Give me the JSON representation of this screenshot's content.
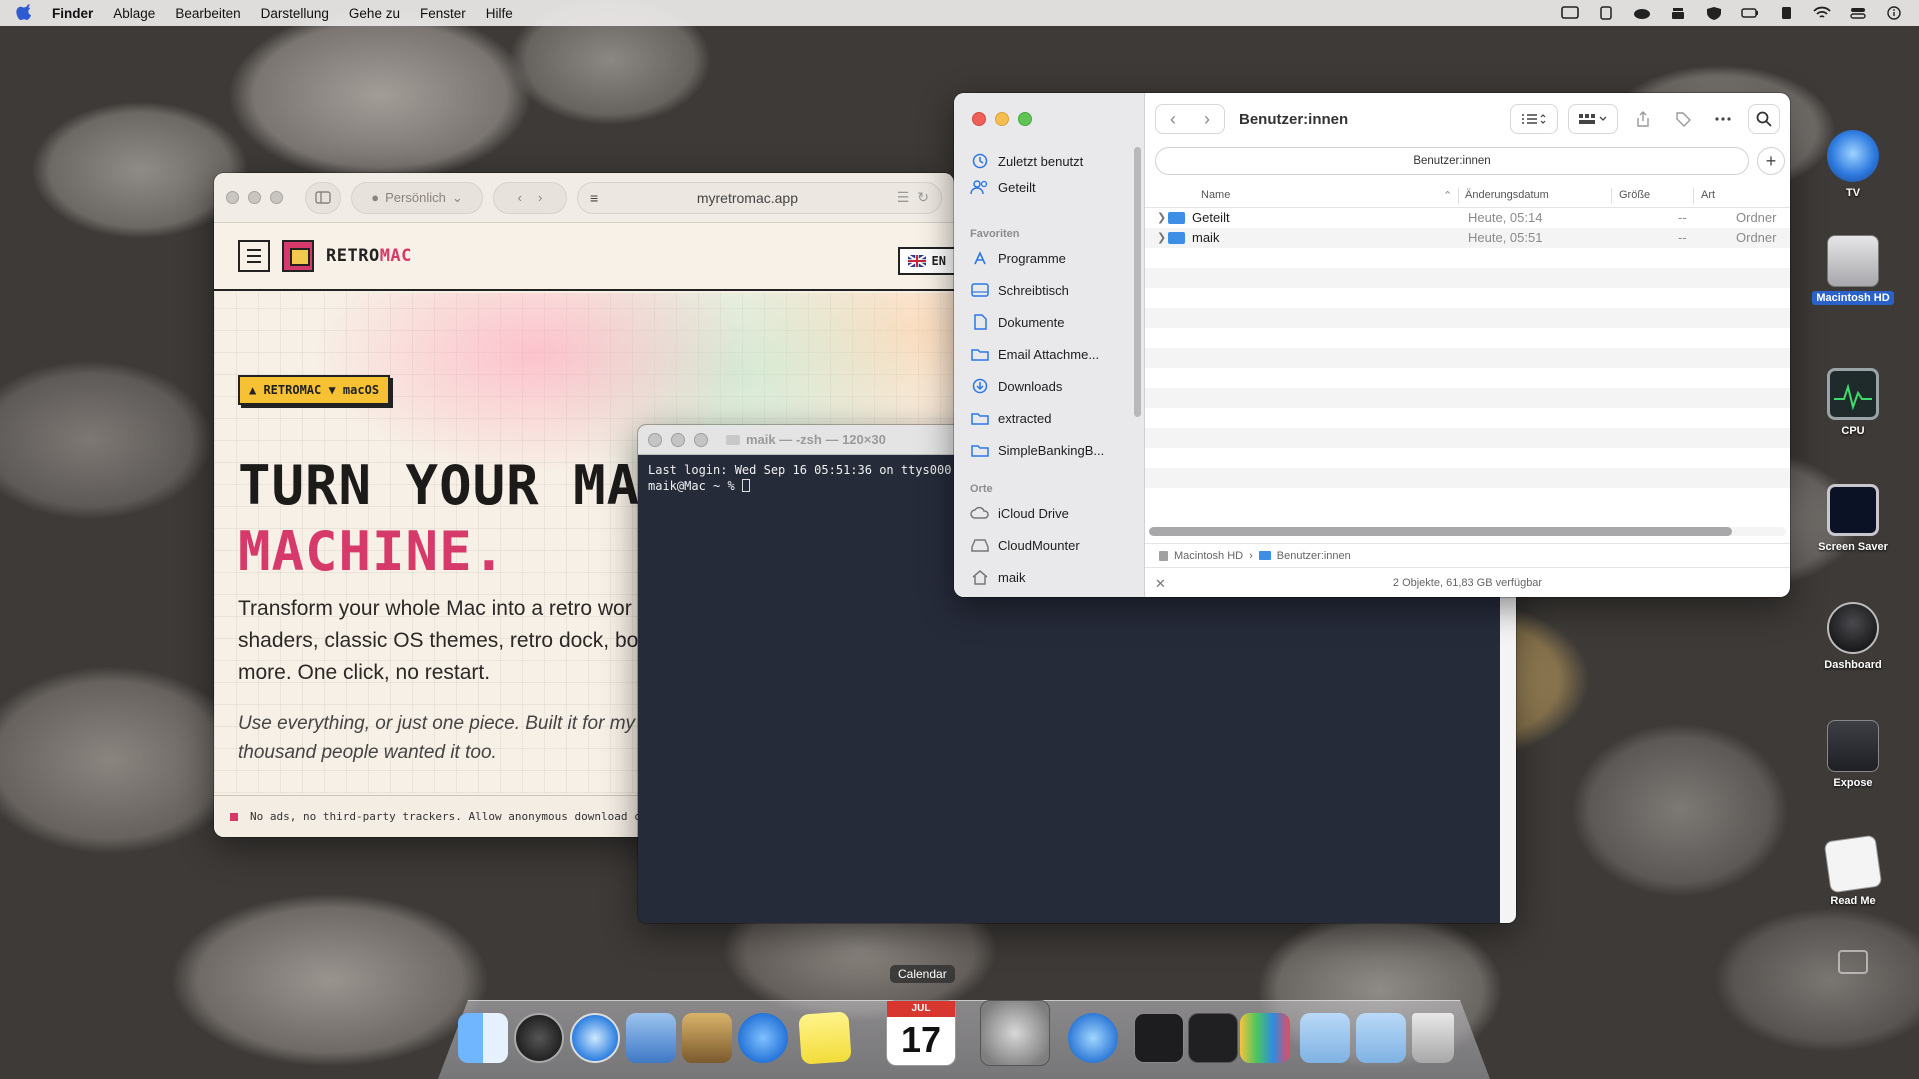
{
  "menubar": {
    "app_name": "Finder",
    "items": [
      "Ablage",
      "Bearbeiten",
      "Darstellung",
      "Gehe zu",
      "Fenster",
      "Hilfe"
    ]
  },
  "browser": {
    "profile_label": "Persönlich",
    "url": "myretromac.app",
    "brand_a": "RETRO",
    "brand_b": "MAC",
    "lang": "EN",
    "tag": "▲ RETROMAC ▼ macOS",
    "headline_1": "TURN YOUR MAC",
    "headline_2": "MACHINE.",
    "sub_1": "Transform your whole Mac into a retro wor",
    "sub_2": "shaders, classic OS themes, retro dock, bo",
    "sub_3": "more. One click, no restart.",
    "note_1": "Use everything, or just one piece. Built it for my",
    "note_2": "thousand people wanted it too.",
    "footer": "No ads, no third-party trackers. Allow anonymous download c"
  },
  "terminal": {
    "title": "maik — -zsh — 120×30",
    "line_1": "Last login: Wed Sep 16 05:51:36 on ttys000",
    "prompt": "maik@Mac ~ % "
  },
  "finder": {
    "title": "Benutzer:innen",
    "path_field": "Benutzer:innen",
    "sidebar": {
      "top_items": [
        "Zuletzt benutzt",
        "Geteilt"
      ],
      "favorites_header": "Favoriten",
      "favorites": [
        "Programme",
        "Schreibtisch",
        "Dokumente",
        "Email Attachme...",
        "Downloads",
        "extracted",
        "SimpleBankingB..."
      ],
      "places_header": "Orte",
      "places": [
        "iCloud Drive",
        "CloudMounter",
        "maik"
      ]
    },
    "columns": {
      "name": "Name",
      "date": "Änderungsdatum",
      "size": "Größe",
      "kind": "Art"
    },
    "rows": [
      {
        "name": "Geteilt",
        "date": "Heute, 05:14",
        "size": "--",
        "kind": "Ordner"
      },
      {
        "name": "maik",
        "date": "Heute, 05:51",
        "size": "--",
        "kind": "Ordner"
      }
    ],
    "path_bar": [
      "Macintosh HD",
      "Benutzer:innen"
    ],
    "status": "2 Objekte, 61,83 GB verfügbar"
  },
  "desktop_icons": [
    "TV",
    "Macintosh HD",
    "CPU",
    "Screen Saver",
    "Dashboard",
    "Expose",
    "Read Me"
  ],
  "dock": {
    "tooltip": "Calendar",
    "calendar_month": "JUL",
    "calendar_day": "17"
  }
}
